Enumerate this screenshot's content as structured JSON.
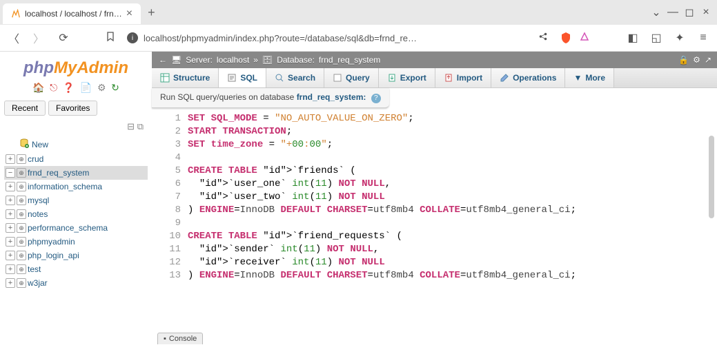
{
  "browser": {
    "tab_title": "localhost / localhost / frn…",
    "url": "localhost/phpmyadmin/index.php?route=/database/sql&db=frnd_re…"
  },
  "logo": {
    "php": "php",
    "my": "My",
    "admin": "Admin"
  },
  "sidebar": {
    "recent": "Recent",
    "favorites": "Favorites",
    "new": "New",
    "items": [
      {
        "label": "crud"
      },
      {
        "label": "frnd_req_system"
      },
      {
        "label": "information_schema"
      },
      {
        "label": "mysql"
      },
      {
        "label": "notes"
      },
      {
        "label": "performance_schema"
      },
      {
        "label": "phpmyadmin"
      },
      {
        "label": "php_login_api"
      },
      {
        "label": "test"
      },
      {
        "label": "w3jar"
      }
    ]
  },
  "breadcrumb": {
    "server_label": "Server:",
    "server": "localhost",
    "sep": "»",
    "db_label": "Database:",
    "db": "frnd_req_system"
  },
  "tabs": {
    "structure": "Structure",
    "sql": "SQL",
    "search": "Search",
    "query": "Query",
    "export": "Export",
    "import": "Import",
    "operations": "Operations",
    "more": "More"
  },
  "infobar": {
    "prefix": "Run SQL query/queries on database ",
    "db": "frnd_req_system:"
  },
  "code_lines": [
    "SET SQL_MODE = \"NO_AUTO_VALUE_ON_ZERO\";",
    "START TRANSACTION;",
    "SET time_zone = \"+00:00\";",
    "",
    "CREATE TABLE `friends` (",
    "  `user_one` int(11) NOT NULL,",
    "  `user_two` int(11) NOT NULL",
    ") ENGINE=InnoDB DEFAULT CHARSET=utf8mb4 COLLATE=utf8mb4_general_ci;",
    "",
    "CREATE TABLE `friend_requests` (",
    "  `sender` int(11) NOT NULL,",
    "  `receiver` int(11) NOT NULL",
    ") ENGINE=InnoDB DEFAULT CHARSET=utf8mb4 COLLATE=utf8mb4_general_ci;"
  ],
  "console": "Console"
}
